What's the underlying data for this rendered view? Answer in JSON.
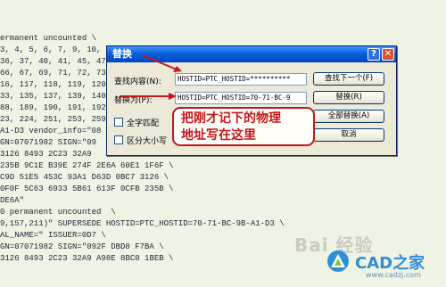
{
  "editor": {
    "lines": [
      "ermanent uncounted \\",
      "3, 4, 5, 6, 7, 9, 10, 14, 16, 2",
      "36, 37, 40, 41, 45, 47, 4",
      "66, 67, 69, 71, 72, 73, 7",
      "16, 117, 118, 119, 120, 1",
      "33, 135, 137, 139, 140, 14",
      "88, 189, 190, 191, 192, 1",
      "23, 224, 251, 253, 259, 2",
      "A1-D3 vendor_info=\"08",
      "GN=07071982 SIGN=\"09",
      "3126 8493 2C23 32A9",
      "235B 9C1E B39E 274F 2E6A 60E1 1F6F \\",
      "C9D 51E5 453C 93A1 D63D 0BC7 3126 \\",
      "0F0F 5C63 6933 5B61 613F 0CFB 235B \\",
      "DE6A\"",
      "0 permanent uncounted  \\",
      "9,157,211)\" SUPERSEDE HOSTID=PTC_HOSTID=70-71-BC-9B-A1-D3 \\",
      "AL_NAME=\" ISSUER=0D7 \\",
      "GN=07071982 SIGN=\"092F DBD8 F7BA \\",
      "3126 8493 2C23 32A9 A98E 8BC0 1BEB \\"
    ]
  },
  "dialog": {
    "title": "替换",
    "help_glyph": "?",
    "close_glyph": "✕",
    "find_label": "查找内容(N):",
    "find_value": "HOSTID=PTC_HOSTID=**********",
    "replace_label": "替换为(P):",
    "replace_value": "HOSTID=PTC_HOSTID=70-71-BC-9",
    "whole_word_label": "全字匹配",
    "match_case_label": "区分大小写",
    "buttons": {
      "find_next": "查找下一个(F)",
      "replace": "替换(R)",
      "replace_all": "全部替换(A)",
      "cancel": "取消"
    }
  },
  "annotation": {
    "line1": "把刚才记下的物理",
    "line2": "地址写在这里",
    "color": "#c4161c"
  },
  "watermark": {
    "baidu": "Bai 经验",
    "cad": "CAD之家",
    "url": "www.cadzj.com"
  }
}
